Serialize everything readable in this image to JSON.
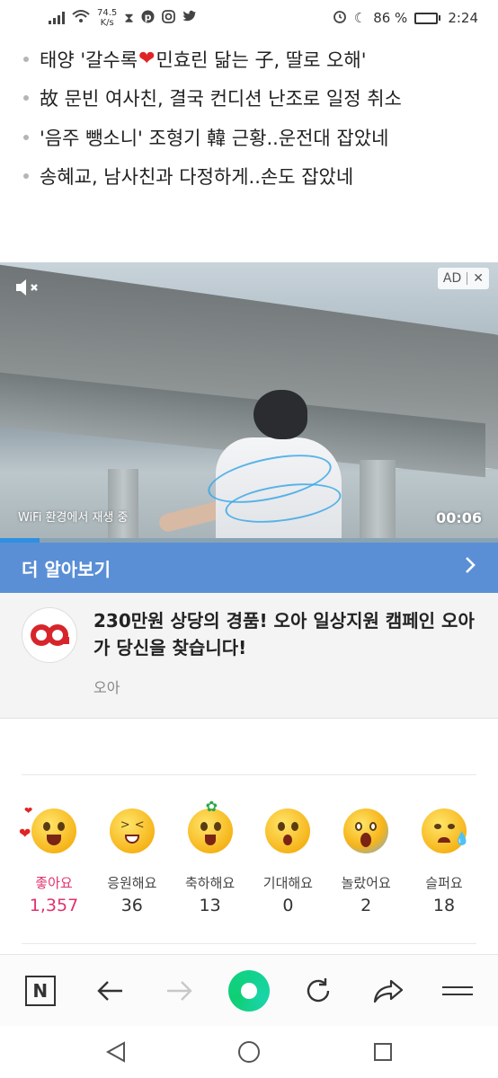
{
  "status_bar": {
    "network_speed_value": "74.5",
    "network_speed_unit": "K/s",
    "battery_percent": "86 %",
    "battery_level": 0.86,
    "time": "2:24",
    "icons": [
      "signal-icon",
      "wifi-icon",
      "hourglass-icon",
      "pinterest-icon",
      "instagram-icon",
      "twitter-icon",
      "alarm-icon",
      "moon-icon",
      "battery-icon"
    ]
  },
  "headlines": [
    {
      "before": "태양 '갈수록 ",
      "emoji": "❤",
      "after": "민효린 닮는 子, 딸로 오해'"
    },
    {
      "before": "故 문빈 여사친, 결국 컨디션 난조로 일정 취소",
      "emoji": "",
      "after": ""
    },
    {
      "before": "'음주 뺑소니' 조형기 韓 근황..운전대 잡았네",
      "emoji": "",
      "after": ""
    },
    {
      "before": "송혜교, 남사친과 다정하게..손도 잡았네",
      "emoji": "",
      "after": ""
    }
  ],
  "video_ad": {
    "ad_label": "AD",
    "close_label": "✕",
    "mute_icon": "mute-icon",
    "wifi_note": "WiFi 환경에서 재생 중",
    "duration": "00:06",
    "progress": 0.08
  },
  "learn_more": {
    "label": "더 알아보기",
    "chevron": "›"
  },
  "ad_card": {
    "headline": "230만원 상당의 경품! 오아 일상지원 캠페인 오아가 당신을 찾습니다!",
    "advertiser": "오아",
    "logo_color": "#d6262b"
  },
  "reactions": [
    {
      "label": "좋아요",
      "count": "1,357",
      "active": true
    },
    {
      "label": "응원해요",
      "count": "36",
      "active": false
    },
    {
      "label": "축하해요",
      "count": "13",
      "active": false
    },
    {
      "label": "기대해요",
      "count": "0",
      "active": false
    },
    {
      "label": "놀랐어요",
      "count": "2",
      "active": false
    },
    {
      "label": "슬퍼요",
      "count": "18",
      "active": false
    }
  ],
  "toolbar": {
    "home_label": "N",
    "icons": [
      "n-home-icon",
      "back-arrow-icon",
      "forward-arrow-icon",
      "green-dot-icon",
      "refresh-icon",
      "share-icon",
      "menu-icon"
    ]
  },
  "colors": {
    "accent_blue": "#5a8fd6",
    "reaction_active": "#e0336d",
    "green_button": "#12d28a"
  }
}
